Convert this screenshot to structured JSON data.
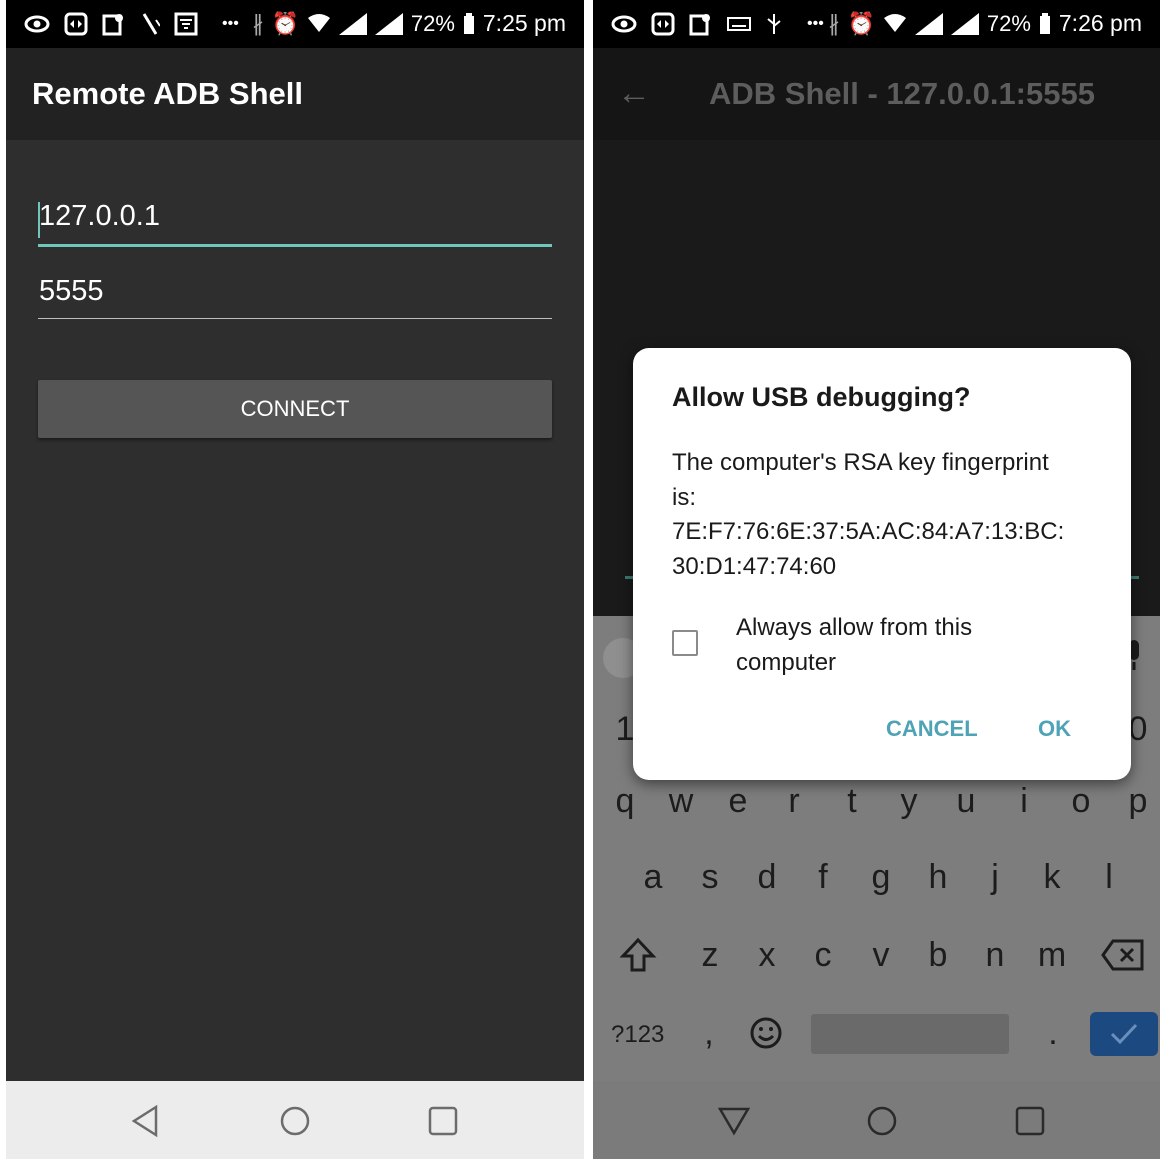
{
  "left": {
    "status": {
      "battery": "72%",
      "time": "7:25 pm"
    },
    "app_title": "Remote ADB Shell",
    "host_value": "127.0.0.1",
    "port_value": "5555",
    "connect_label": "CONNECT"
  },
  "right": {
    "status": {
      "battery": "72%",
      "time": "7:26 pm"
    },
    "title": "ADB Shell - 127.0.0.1:5555",
    "dialog": {
      "title": "Allow USB debugging?",
      "body_line1": "The computer's RSA key fingerprint",
      "body_line2": "is:",
      "body_line3": "7E:F7:76:6E:37:5A:AC:84:A7:13:BC:",
      "body_line4": "30:D1:47:74:60",
      "checkbox_line1": "Always allow from this",
      "checkbox_line2": "computer",
      "checkbox_checked": false,
      "cancel_label": "CANCEL",
      "ok_label": "OK"
    },
    "keyboard": {
      "row_numbers_visible": [
        "1",
        "0"
      ],
      "row1": [
        "q",
        "w",
        "e",
        "r",
        "t",
        "y",
        "u",
        "i",
        "o",
        "p"
      ],
      "row2": [
        "a",
        "s",
        "d",
        "f",
        "g",
        "h",
        "j",
        "k",
        "l"
      ],
      "row3": [
        "z",
        "x",
        "c",
        "v",
        "b",
        "n",
        "m"
      ],
      "symbols_key": "?123",
      "comma_key": ",",
      "period_key": "."
    }
  },
  "colors": {
    "accent": "#6fc6bb",
    "dialog_button": "#4fa3b6",
    "dark_bg": "#2e2e2e"
  }
}
